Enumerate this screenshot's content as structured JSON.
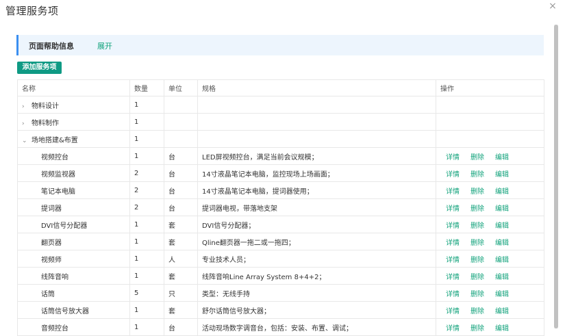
{
  "modal": {
    "title": "管理服务项",
    "close_glyph": "×"
  },
  "help": {
    "title": "页面帮助信息",
    "toggle": "展开"
  },
  "toolbar": {
    "add_label": "添加服务项"
  },
  "table": {
    "headers": [
      "名称",
      "数量",
      "单位",
      "规格",
      "操作"
    ],
    "groups": [
      {
        "name": "物料设计",
        "qty": "1",
        "expanded": false
      },
      {
        "name": "物料制作",
        "qty": "1",
        "expanded": false
      },
      {
        "name": "场地搭建&布置",
        "qty": "1",
        "expanded": true
      }
    ],
    "rows": [
      {
        "name": "视频控台",
        "qty": "1",
        "unit": "台",
        "spec": "LED屏视频控台，满足当前会议规模；"
      },
      {
        "name": "视频监视器",
        "qty": "2",
        "unit": "台",
        "spec": "14寸液晶笔记本电脑，监控现场上场画面；"
      },
      {
        "name": "笔记本电脑",
        "qty": "2",
        "unit": "台",
        "spec": "14寸液晶笔记本电脑，提词器使用；"
      },
      {
        "name": "提词器",
        "qty": "2",
        "unit": "台",
        "spec": "提词器电视，带落地支架"
      },
      {
        "name": "DVI信号分配器",
        "qty": "1",
        "unit": "套",
        "spec": "DVI信号分配器；"
      },
      {
        "name": "翻页器",
        "qty": "1",
        "unit": "套",
        "spec": "Qline翻页器一拖二或一拖四；"
      },
      {
        "name": "视频师",
        "qty": "1",
        "unit": "人",
        "spec": "专业技术人员；"
      },
      {
        "name": "线阵音响",
        "qty": "1",
        "unit": "套",
        "spec": "线阵音响Line Array System 8+4+2；"
      },
      {
        "name": "话筒",
        "qty": "5",
        "unit": "只",
        "spec": "类型：无线手持"
      },
      {
        "name": "话筒信号放大器",
        "qty": "1",
        "unit": "套",
        "spec": "舒尔话筒信号放大器；"
      },
      {
        "name": "音频控台",
        "qty": "1",
        "unit": "台",
        "spec": "活动现场数字调音台，包括：安装、布置、调试；"
      }
    ],
    "actions": {
      "detail": "详情",
      "delete": "删除",
      "edit": "编辑"
    }
  },
  "icons": {
    "collapsed": "chevron-right-icon",
    "expanded": "chevron-down-icon",
    "close": "close-icon"
  },
  "colors": {
    "accent": "#11a27b",
    "button": "#0f9a84",
    "help_border": "#3b8ff0",
    "help_bg": "#edf5fd"
  }
}
